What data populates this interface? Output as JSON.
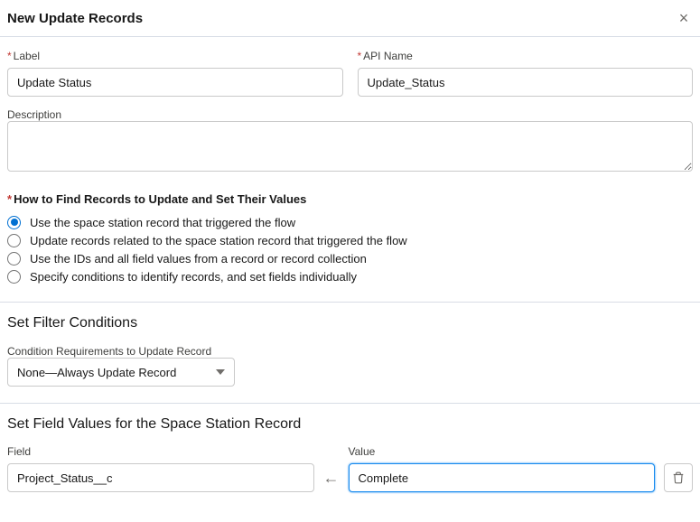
{
  "header": {
    "title": "New Update Records"
  },
  "basic": {
    "label_field": {
      "label": "Label",
      "value": "Update Status"
    },
    "api_field": {
      "label": "API Name",
      "value": "Update_Status"
    },
    "description": {
      "label": "Description",
      "value": ""
    }
  },
  "find_records": {
    "legend": "How to Find Records to Update and Set Their Values",
    "options": [
      {
        "label": "Use the space station record that triggered the flow",
        "selected": true
      },
      {
        "label": "Update records related to the space station record that triggered the flow",
        "selected": false
      },
      {
        "label": "Use the IDs and all field values from a record or record collection",
        "selected": false
      },
      {
        "label": "Specify conditions to identify records, and set fields individually",
        "selected": false
      }
    ]
  },
  "filter": {
    "heading": "Set Filter Conditions",
    "requirements_label": "Condition Requirements to Update Record",
    "requirements_value": "None—Always Update Record"
  },
  "set_values": {
    "heading": "Set Field Values for the Space Station Record",
    "field_label": "Field",
    "value_label": "Value",
    "rows": [
      {
        "field": "Project_Status__c",
        "value": "Complete"
      }
    ]
  }
}
